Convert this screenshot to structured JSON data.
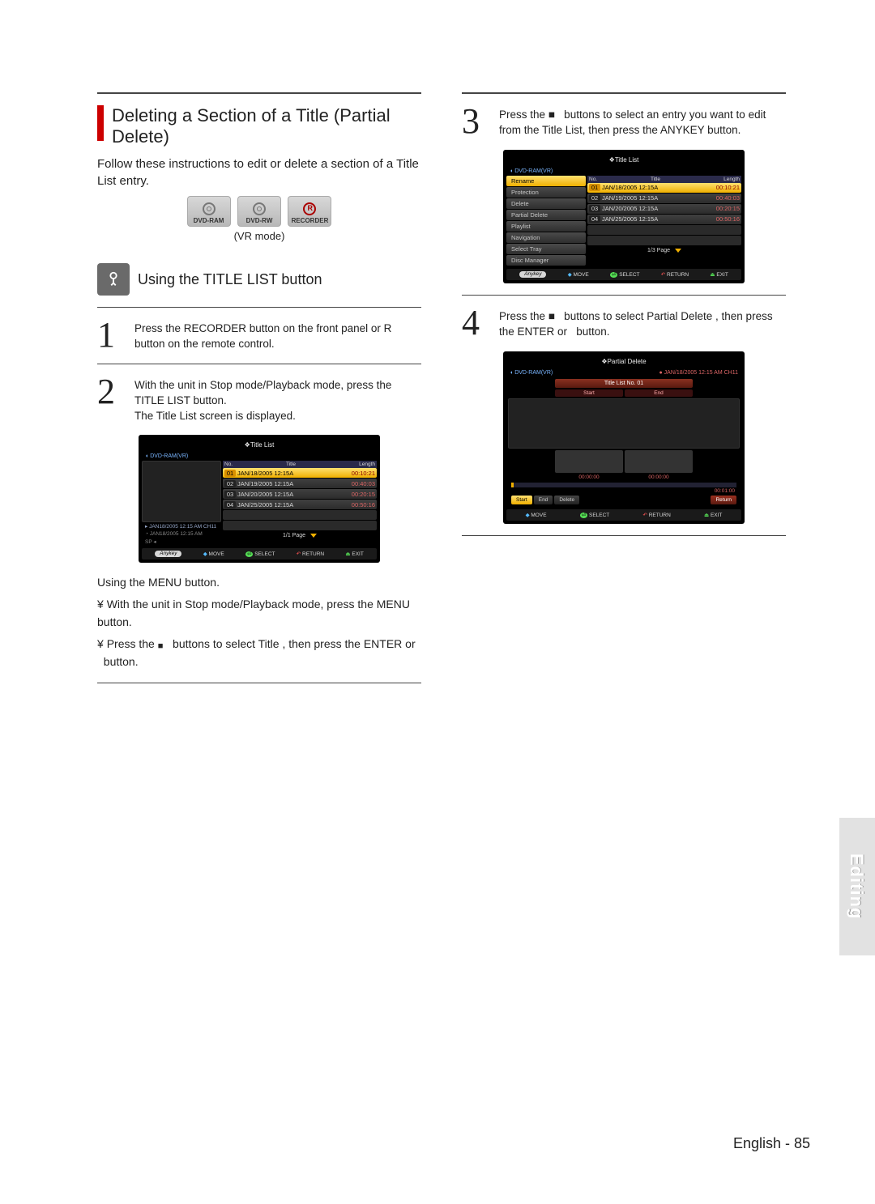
{
  "section": {
    "heading": "Deleting a Section of a Title (Partial Delete)",
    "intro": "Follow these instructions to edit or delete a section of a Title List entry.",
    "discs": {
      "ram": "DVD-RAM",
      "rw": "DVD-RW",
      "rec": "RECORDER"
    },
    "mode": "(VR mode)",
    "sub": "Using the TITLE LIST button"
  },
  "steps": {
    "s1": "Press the RECORDER button on the front panel or R button on the remote control.",
    "s2a": "With the unit in Stop mode/Playback mode, press the TITLE LIST button.",
    "s2b": "The Title List screen is displayed.",
    "s3": "Press the ■   buttons to select an entry you want to edit from the Title List, then press the ANYKEY button.",
    "s4": "Press the ■   buttons to select Partial Delete , then press the ENTER or   button."
  },
  "menu": {
    "heading": "Using the MENU button.",
    "l1": "With the unit in Stop mode/Playback mode, press the MENU button.",
    "l2a": "Press the",
    "l2b": "buttons to select Title , then press the ENTER or   button."
  },
  "osd": {
    "title_list": "Title List",
    "partial_delete": "Partial Delete",
    "media": "DVD-RAM(VR)",
    "cols": {
      "no": "No.",
      "title": "Title",
      "length": "Length"
    },
    "rows": [
      {
        "no": "01",
        "title": "JAN/18/2005 12:15A",
        "len": "00:10:21"
      },
      {
        "no": "02",
        "title": "JAN/19/2005 12:15A",
        "len": "00:40:03"
      },
      {
        "no": "03",
        "title": "JAN/20/2005 12:15A",
        "len": "00:20:15"
      },
      {
        "no": "04",
        "title": "JAN/25/2005 12:15A",
        "len": "00:50:16"
      }
    ],
    "info1": "JAN18/2005 12:15 AM CH11",
    "info2": "JAN18/2005 12:15 AM",
    "sp": "SP",
    "page11": "1/1 Page",
    "page13": "1/3 Page",
    "menu": [
      "Rename",
      "Protection",
      "Delete",
      "Partial Delete",
      "Playlist",
      "Navigation",
      "Select Tray",
      "Disc Manager"
    ],
    "footer": {
      "anykey": "Anykey",
      "move": "MOVE",
      "select": "SELECT",
      "return": "RETURN",
      "exit": "EXIT"
    },
    "pd": {
      "rec": "JAN/18/2005 12:15 AM CH11",
      "tln": "Title List No. 01",
      "start": "Start",
      "end": "End",
      "t0": "00:00:00",
      "t1": "00:00:00",
      "cur": "00:01:00",
      "bStart": "Start",
      "bEnd": "End",
      "bDelete": "Delete",
      "bReturn": "Return"
    }
  },
  "sidetab": "Editing",
  "footer": "English - 85"
}
